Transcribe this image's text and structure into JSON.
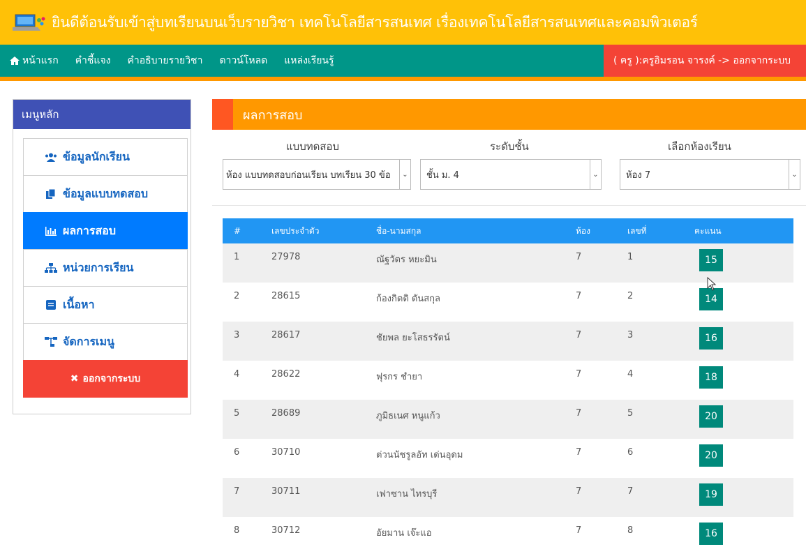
{
  "header": {
    "title": "ยินดีต้อนรับเข้าสู่บทเรียนบนเว็บรายวิชา เทคโนโลยีสารสนเทศ เรื่องเทคโนโลยีสารสนเทศและคอมพิวเตอร์",
    "logo_icon": "laptop-logo-icon"
  },
  "nav": {
    "items": [
      {
        "label": "หน้าแรก",
        "icon": "home-icon"
      },
      {
        "label": "คำชี้แจง"
      },
      {
        "label": "คำอธิบายรายวิชา"
      },
      {
        "label": "ดาวน์โหลด"
      },
      {
        "label": "แหล่งเรียนรู้"
      }
    ],
    "user": "( ครู ):ครูอิมรอน จารงค์ -> ออกจากระบบ"
  },
  "sidebar": {
    "title": "เมนูหลัก",
    "items": [
      {
        "label": "ข้อมูลนักเรียน",
        "icon": "users-icon"
      },
      {
        "label": "ข้อมูลแบบทดสอบ",
        "icon": "copy-icon"
      },
      {
        "label": "ผลการสอบ",
        "icon": "bar-chart-icon",
        "active": true
      },
      {
        "label": "หน่วยการเรียน",
        "icon": "sitemap-icon"
      },
      {
        "label": "เนื้อหา",
        "icon": "book-icon"
      },
      {
        "label": "จัดการเมนู",
        "icon": "tree-icon"
      }
    ],
    "logout": "ออกจากระบบ"
  },
  "main": {
    "title": "ผลการสอบ",
    "filters": {
      "test_label": "แบบทดสอบ",
      "test_value": "ห้อง แบบทดสอบก่อนเรียน บทเรียน 30 ข้อ",
      "level_label": "ระดับชั้น",
      "level_value": "ชั้น ม. 4",
      "room_label": "เลือกห้องเรียน",
      "room_value": "ห้อง 7"
    },
    "table": {
      "headers": [
        "#",
        "เลขประจำตัว",
        "ชื่อ-นามสกุล",
        "ห้อง",
        "เลขที่",
        "คะแนน"
      ],
      "rows": [
        [
          "1",
          "27978",
          "ณัฐวัตร หยะมิน",
          "7",
          "1",
          "15"
        ],
        [
          "2",
          "28615",
          "ก้องกิตติ ตันสกุล",
          "7",
          "2",
          "14"
        ],
        [
          "3",
          "28617",
          "ชัยพล ยะโสธรรัตน์",
          "7",
          "3",
          "16"
        ],
        [
          "4",
          "28622",
          "ฟุรกร ชำยา",
          "7",
          "4",
          "18"
        ],
        [
          "5",
          "28689",
          "ภูมิธเนศ หนูแก้ว",
          "7",
          "5",
          "20"
        ],
        [
          "6",
          "30710",
          "ต่วนนัชรูลอัท เด่นอุดม",
          "7",
          "6",
          "20"
        ],
        [
          "7",
          "30711",
          "เฟาซาน ไทรบุรี",
          "7",
          "7",
          "19"
        ],
        [
          "8",
          "30712",
          "อัยมาน เจ๊ะแอ",
          "7",
          "8",
          "16"
        ]
      ]
    }
  },
  "colors": {
    "header_bg": "#ffc107",
    "nav_bg": "#009688",
    "user_bg": "#f44336",
    "sidebar_head": "#3f51b5",
    "active": "#007bff",
    "panel": "#ff9800",
    "table_head": "#2196f3",
    "score_bg": "#00897b"
  }
}
